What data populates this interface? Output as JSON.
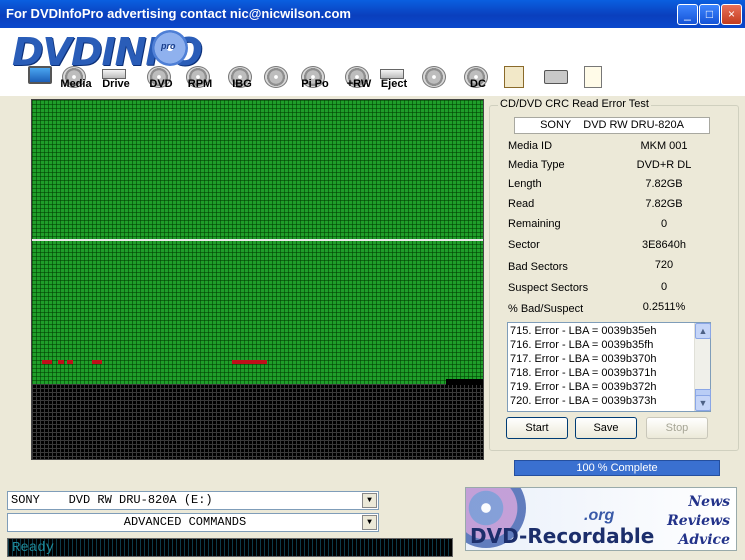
{
  "window": {
    "title": "For DVDInfoPro advertising contact nic@nicwilson.com",
    "controls": {
      "minimize": "_",
      "maximize": "□",
      "close": "×"
    }
  },
  "logo": {
    "text": "DVDINFO",
    "badge": "pro"
  },
  "toolbar": [
    {
      "label": "",
      "icon": "monitor-icon"
    },
    {
      "label": "Media",
      "icon": "disc-icon"
    },
    {
      "label": "Drive",
      "icon": "drive-icon"
    },
    {
      "label": "DVD",
      "icon": "disc-icon"
    },
    {
      "label": "RPM",
      "icon": "disc-icon"
    },
    {
      "label": "IBG",
      "icon": "disc-icon"
    },
    {
      "label": "",
      "icon": "magnifier-icon"
    },
    {
      "label": "Pi Po",
      "icon": "disc-icon"
    },
    {
      "label": "+RW",
      "icon": "disc-icon"
    },
    {
      "label": "Eject",
      "icon": "drive-icon"
    },
    {
      "label": "",
      "icon": "disc-pen-icon"
    },
    {
      "label": "DC",
      "icon": "disc-icon"
    },
    {
      "label": "",
      "icon": "clipboard-icon"
    },
    {
      "label": "",
      "icon": "camera-icon"
    },
    {
      "label": "",
      "icon": "notepad-icon"
    }
  ],
  "graph": {
    "green_fill_fraction": 0.785,
    "error_markers": [
      "error-mark-1",
      "error-mark-2",
      "error-mark-3",
      "error-mark-4",
      "error-mark-5"
    ]
  },
  "panel": {
    "title": "CD/DVD CRC Read Error Test",
    "drive": "SONY    DVD RW DRU-820A",
    "fields": [
      {
        "label": "Media ID",
        "value": "MKM    001"
      },
      {
        "label": "Media Type",
        "value": "DVD+R DL"
      },
      {
        "label": "Length",
        "value": "7.82GB"
      },
      {
        "label": "Read",
        "value": "7.82GB"
      },
      {
        "label": "Remaining",
        "value": "0"
      },
      {
        "label": "Sector",
        "value": "3E8640h"
      },
      {
        "label": "Bad Sectors",
        "value": "720"
      },
      {
        "label": "Suspect Sectors",
        "value": "0"
      },
      {
        "label": "% Bad/Suspect",
        "value": "0.2511%"
      }
    ],
    "log": [
      "715. Error - LBA = 0039b35eh",
      "716. Error - LBA = 0039b35fh",
      "717. Error - LBA = 0039b370h",
      "718. Error - LBA = 0039b371h",
      "719. Error - LBA = 0039b372h",
      "720. Error - LBA = 0039b373h"
    ],
    "buttons": {
      "start": "Start",
      "save": "Save",
      "stop": "Stop"
    },
    "progress": {
      "text": "100 % Complete",
      "value": 100
    }
  },
  "drive_select": {
    "value": "SONY    DVD RW DRU-820A (E:)"
  },
  "command_select": {
    "value": "ADVANCED COMMANDS"
  },
  "status": {
    "text": "Ready"
  },
  "ad": {
    "brand": "DVD-Recordable",
    "domain": ".org",
    "words": [
      "News",
      "Reviews",
      "Advice"
    ]
  }
}
